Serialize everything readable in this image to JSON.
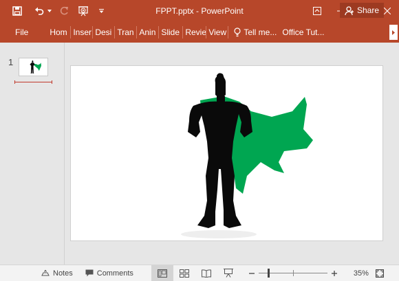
{
  "window": {
    "title": "FPPT.pptx - PowerPoint"
  },
  "quick_access": {
    "save_icon": "save-icon",
    "undo_icon": "undo-icon",
    "redo_icon": "redo-icon",
    "present_icon": "present-from-beginning-icon"
  },
  "ribbon": {
    "file": "File",
    "tabs": [
      "Hom",
      "Inser",
      "Desi",
      "Tran",
      "Anin",
      "Slide",
      "Revie",
      "View"
    ],
    "tell_me": "Tell me...",
    "office_tab": "Office Tut...",
    "share": "Share"
  },
  "thumbnails": {
    "slide_number": "1"
  },
  "status": {
    "notes": "Notes",
    "comments": "Comments",
    "zoom": "35%",
    "zoom_level_fraction": 0.35
  },
  "colors": {
    "accent": "#b7472a",
    "cape": "#00a651",
    "silhouette": "#0a0a0a"
  }
}
